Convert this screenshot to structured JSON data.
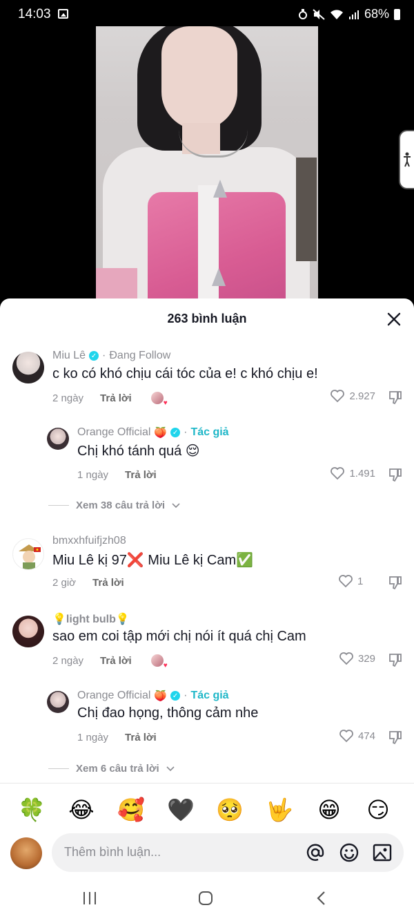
{
  "status_bar": {
    "time": "14:03",
    "battery": "68%"
  },
  "sheet": {
    "title": "263 bình luận"
  },
  "comments": [
    {
      "name": "Miu Lê",
      "follow": "Đang Follow",
      "text": "c ko có khó chịu cái tóc của e! c khó chịu e!",
      "time": "2 ngày",
      "reply": "Trả lời",
      "likes": "2.927"
    },
    {
      "name": "Orange Official",
      "name_emoji": "🍑",
      "badge": "Tác giả",
      "text": "Chị khó tánh quá 😌",
      "time": "1 ngày",
      "reply": "Trả lời",
      "likes": "1.491"
    },
    {
      "name": "bmxxhfuifjzh08",
      "text": "Miu Lê kị 97❌ Miu Lê kị Cam✅",
      "time": "2 giờ",
      "reply": "Trả lời",
      "likes": "1"
    },
    {
      "name": "💡light bulb💡",
      "text": "sao em coi tập mới chị nói ít quá chị Cam",
      "time": "2 ngày",
      "reply": "Trả lời",
      "likes": "329"
    },
    {
      "name": "Orange Official",
      "name_emoji": "🍑",
      "badge": "Tác giả",
      "text": "Chị đao họng, thông cảm nhe",
      "time": "1 ngày",
      "reply": "Trả lời",
      "likes": "474"
    }
  ],
  "view_more": [
    {
      "label": "Xem 38 câu trả lời"
    },
    {
      "label": "Xem 6 câu trả lời"
    }
  ],
  "emojis": [
    "🍀",
    "😂",
    "🥰",
    "🖤",
    "🥺",
    "🤟",
    "😁",
    "😏"
  ],
  "input": {
    "placeholder": "Thêm bình luận..."
  },
  "icons": [
    "image-icon",
    "mute-icon",
    "wifi-icon",
    "signal-icon",
    "battery-icon",
    "close-icon",
    "heart-icon",
    "dislike-icon",
    "mention-icon",
    "emoji-icon",
    "photo-icon",
    "recent-apps-icon",
    "home-icon",
    "back-icon"
  ]
}
